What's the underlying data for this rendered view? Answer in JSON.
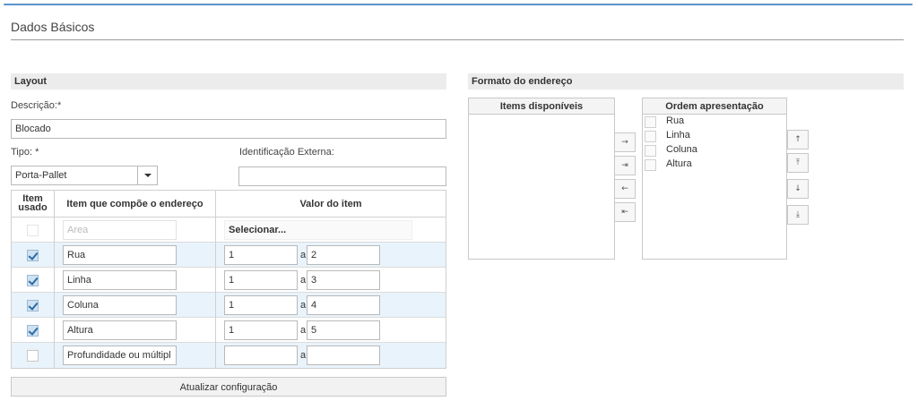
{
  "section": {
    "title": "Dados Básicos"
  },
  "layout": {
    "header": "Layout",
    "descricao_label": "Descrição:*",
    "descricao_value": "Blocado",
    "tipo_label": "Tipo: *",
    "tipo_value": "Porta-Pallet",
    "identificacao_label": "Identificação Externa:",
    "identificacao_value": ""
  },
  "table": {
    "headers": {
      "item_usado": "Item usado",
      "item": "Item que compõe o endereço",
      "valor": "Valor do item"
    },
    "rows": [
      {
        "name": "Area",
        "checked": false,
        "placeholder": true,
        "select_label": "Selecionar..."
      },
      {
        "name": "Rua",
        "checked": true,
        "from": "1",
        "to": "2"
      },
      {
        "name": "Linha",
        "checked": true,
        "from": "1",
        "to": "3"
      },
      {
        "name": "Coluna",
        "checked": true,
        "from": "1",
        "to": "4"
      },
      {
        "name": "Altura",
        "checked": true,
        "from": "1",
        "to": "5"
      },
      {
        "name": "Profundidade ou múltipl",
        "checked": false,
        "from": "",
        "to": ""
      }
    ],
    "separator": "a",
    "update_button": "Atualizar configuração"
  },
  "formato": {
    "header": "Formato do endereço",
    "available_header": "Items disponíveis",
    "order_header": "Ordem apresentação",
    "order_items": [
      "Rua",
      "Linha",
      "Coluna",
      "Altura"
    ],
    "move_buttons": [
      "→",
      "⇥",
      "←",
      "⇤"
    ],
    "order_buttons": [
      "↑",
      "⤒",
      "↓",
      "⤓"
    ]
  },
  "colors": {
    "accent": "#5a93cc",
    "row_alt": "#e9f3fb",
    "check": "#2a6aa6"
  }
}
